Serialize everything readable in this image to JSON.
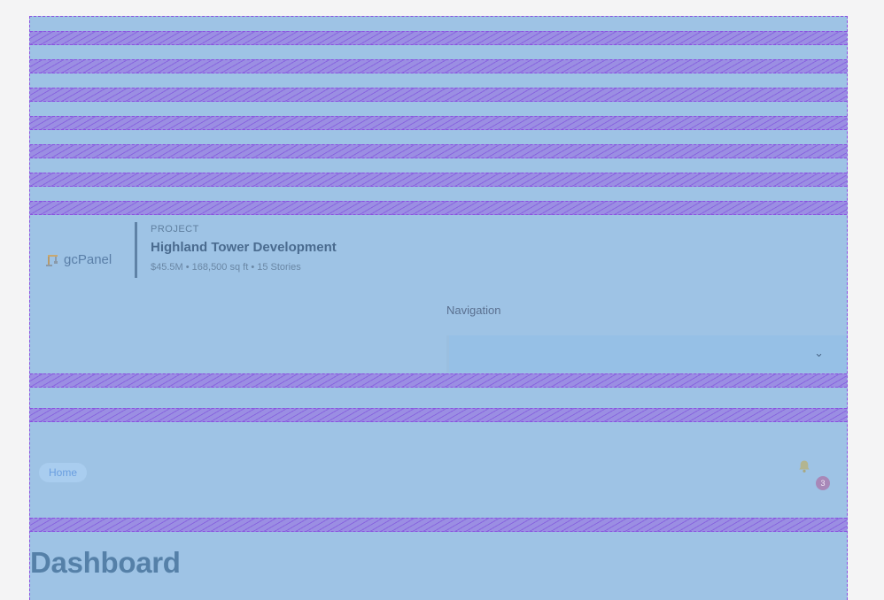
{
  "brand": {
    "name": "gcPanel",
    "icon": "crane-icon"
  },
  "project": {
    "kicker": "PROJECT",
    "title": "Highland Tower Development",
    "meta": "$45.5M • 168,500 sq ft • 15 Stories"
  },
  "navigation": {
    "label": "Navigation",
    "selected": "",
    "icon": "chevron-down-icon"
  },
  "header": {
    "home_label": "Home",
    "notifications": {
      "icon": "bell-icon",
      "count": "3"
    }
  },
  "page": {
    "title": "Dashboard"
  },
  "colors": {
    "panel": "#9ec3e5",
    "stripe": "#9b8ee3",
    "accent": "#8a4fe0",
    "badge": "#a888b8"
  }
}
